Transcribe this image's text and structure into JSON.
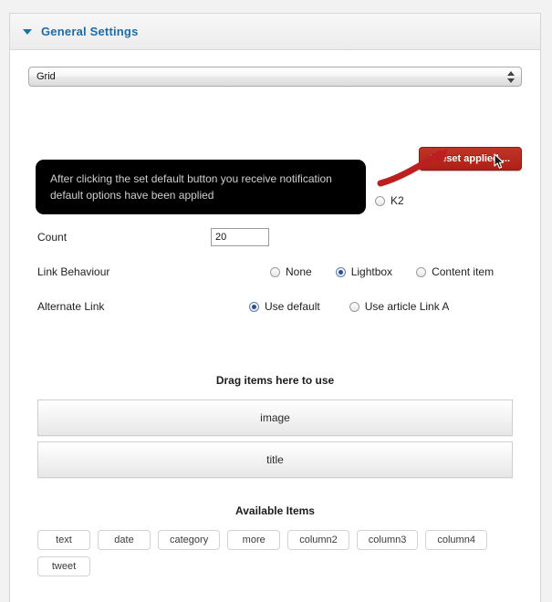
{
  "panel": {
    "title": "General Settings",
    "disclosure_icon": "triangle-down-icon"
  },
  "source_select": {
    "value": "Grid",
    "options": [
      "Grid"
    ],
    "arrows_icon": "select-stepper-icon"
  },
  "preset_button": {
    "label": "Preset applied ...",
    "color": "#b3241c",
    "cursor_icon": "mouse-pointer-icon"
  },
  "annotation": {
    "arrow_icon": "red-arrow-icon",
    "color": "#bb1f1f"
  },
  "tooltip": {
    "text": "After clicking the set default button you receive notification default options have been applied",
    "background": "#000000",
    "text_color": "#cfcfcf"
  },
  "source_row": {
    "k2_label": "K2",
    "k2_checked": false
  },
  "form": {
    "count": {
      "label": "Count",
      "value": "20",
      "placeholder": ""
    },
    "link_behaviour": {
      "label": "Link Behaviour",
      "options": [
        {
          "label": "None",
          "checked": false
        },
        {
          "label": "Lightbox",
          "checked": true
        },
        {
          "label": "Content item",
          "checked": false
        }
      ]
    },
    "alternate_link": {
      "label": "Alternate Link",
      "options": [
        {
          "label": "Use default",
          "checked": true
        },
        {
          "label": "Use article Link A",
          "checked": false
        }
      ]
    }
  },
  "drag_section": {
    "title": "Drag items here to use",
    "items": [
      "image",
      "title"
    ]
  },
  "available_section": {
    "title": "Available Items",
    "items": [
      "text",
      "date",
      "category",
      "more",
      "column2",
      "column3",
      "column4",
      "tweet"
    ]
  }
}
